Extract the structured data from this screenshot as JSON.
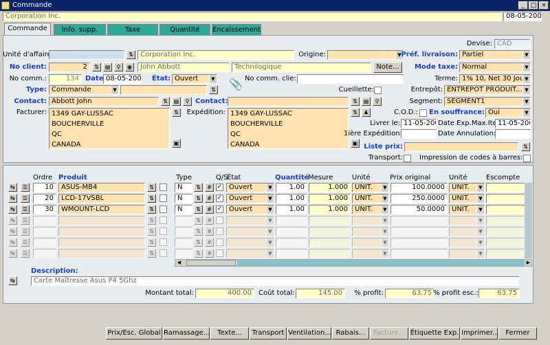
{
  "window": {
    "title": "Commande",
    "minimize": "_",
    "maximize": "□",
    "close": "×"
  },
  "top": {
    "company": "Corporation Inc.",
    "date": "08-05-2009"
  },
  "tabs": [
    "Commande",
    "Info. supp.",
    "Taxe",
    "Quantité",
    "Encaissement"
  ],
  "form": {
    "unite_label": "Unité d'affaire:",
    "unite_value": "",
    "unite_desc": "Corporation Inc.",
    "origine_label": "Origine:",
    "origine_value": "",
    "devise_label": "Devise:",
    "devise_value": "CAD",
    "pref_liv_label": "Préf. livraison:",
    "pref_liv_value": "Partiel",
    "no_client_label": "No client:",
    "no_client_value": "2",
    "client_name": "John Abbott",
    "client_company": "Technilogique",
    "note_btn": "Note...",
    "mode_taxe_label": "Mode taxe:",
    "mode_taxe_value": "Normal",
    "no_comm_label": "No comm.:",
    "no_comm_value": "134",
    "date_label": "Date:",
    "date_value": "08-05-2009",
    "etat_label": "État:",
    "etat_value": "Ouvert",
    "no_comm_clie_label": "No comm. clie:",
    "no_comm_clie_value": "",
    "terme_label": "Terme:",
    "terme_value": "1% 10, Net 30 Jours",
    "type_label": "Type:",
    "type_value": "Commande",
    "type_desc": "",
    "cueillette_label": "Cueillette:",
    "entrepot_label": "Entrepôt:",
    "entrepot_value": "ENTREPÔT PRODUIT...",
    "contact_label": "Contact:",
    "contact_value": "Abbott John",
    "contact2_label": "Contact:",
    "contact2_value": "",
    "segment_label": "Segment:",
    "segment_value": "SEGMENT1",
    "facturer_label": "Facturer:",
    "facturer_lines": [
      "1349 GAY-LUSSAC",
      "BOUCHERVILLE",
      "QC",
      "CANADA"
    ],
    "expedition_label": "Expédition:",
    "expedition_lines": [
      "1349 GAY-LUSSAC",
      "BOUCHERVILLE",
      "QC",
      "CANADA"
    ],
    "cod_label": "C.O.D.:",
    "souffrance_label": "En souffrance:",
    "souffrance_value": "Oui",
    "livrer_label": "Livrer le:",
    "livrer_value": "11-05-2009",
    "date_exp_label": "Date Exp.Max.Item:",
    "date_exp_value": "11-05-2009",
    "premiere_exp_label": "1ière Expédition:",
    "premiere_exp_value": "",
    "date_annul_label": "Date Annulation:",
    "date_annul_value": "",
    "liste_prix_label": "Liste prix:",
    "liste_prix_value": "",
    "transport_label": "Transport:",
    "impression_label": "Impression de codes à barres:"
  },
  "grid": {
    "headers": {
      "ordre": "Ordre",
      "produit": "Produit",
      "type": "Type",
      "qs": "Q/S",
      "etat": "État",
      "quantite": "Quantité",
      "mesure": "Mesure",
      "unite": "Unité",
      "prix": "Prix original",
      "unite2": "Unité",
      "escompte": "Escompte"
    },
    "rows": [
      {
        "ordre": "10",
        "produit": "ASUS-MB4",
        "type": "N",
        "etat": "Ouvert",
        "quantite": "1.00",
        "mesure": "1.000",
        "unite": "UNIT.",
        "prix": "100.0000",
        "unite2": "UNIT."
      },
      {
        "ordre": "20",
        "produit": "LCD-17VSBL",
        "type": "N",
        "etat": "Ouvert",
        "quantite": "1.00",
        "mesure": "1.000",
        "unite": "UNIT.",
        "prix": "250.0000",
        "unite2": "UNIT."
      },
      {
        "ordre": "30",
        "produit": "WMOUNT-LCD",
        "type": "N",
        "etat": "Ouvert",
        "quantite": "1.00",
        "mesure": "1.000",
        "unite": "UNIT.",
        "prix": "50.0000",
        "unite2": "UNIT."
      }
    ],
    "empty_rows": 4
  },
  "description": {
    "label": "Description:",
    "value": "Carte Maîtresse Asus P4 5Ghz"
  },
  "totals": {
    "montant_label": "Montant total:",
    "montant_value": "400.00",
    "cout_label": "Coût total:",
    "cout_value": "145.00",
    "profit_label": "% profit:",
    "profit_value": "63.75",
    "profit_esc_label": "% profit esc.:",
    "profit_esc_value": "63.75"
  },
  "buttons": [
    "Prix/Esc. Global",
    "Ramassage...",
    "Texte...",
    "Transport",
    "Ventilation...",
    "Rabais...",
    "Facture...",
    "Étiquette Exp.",
    "Imprimer...",
    "Fermer"
  ]
}
